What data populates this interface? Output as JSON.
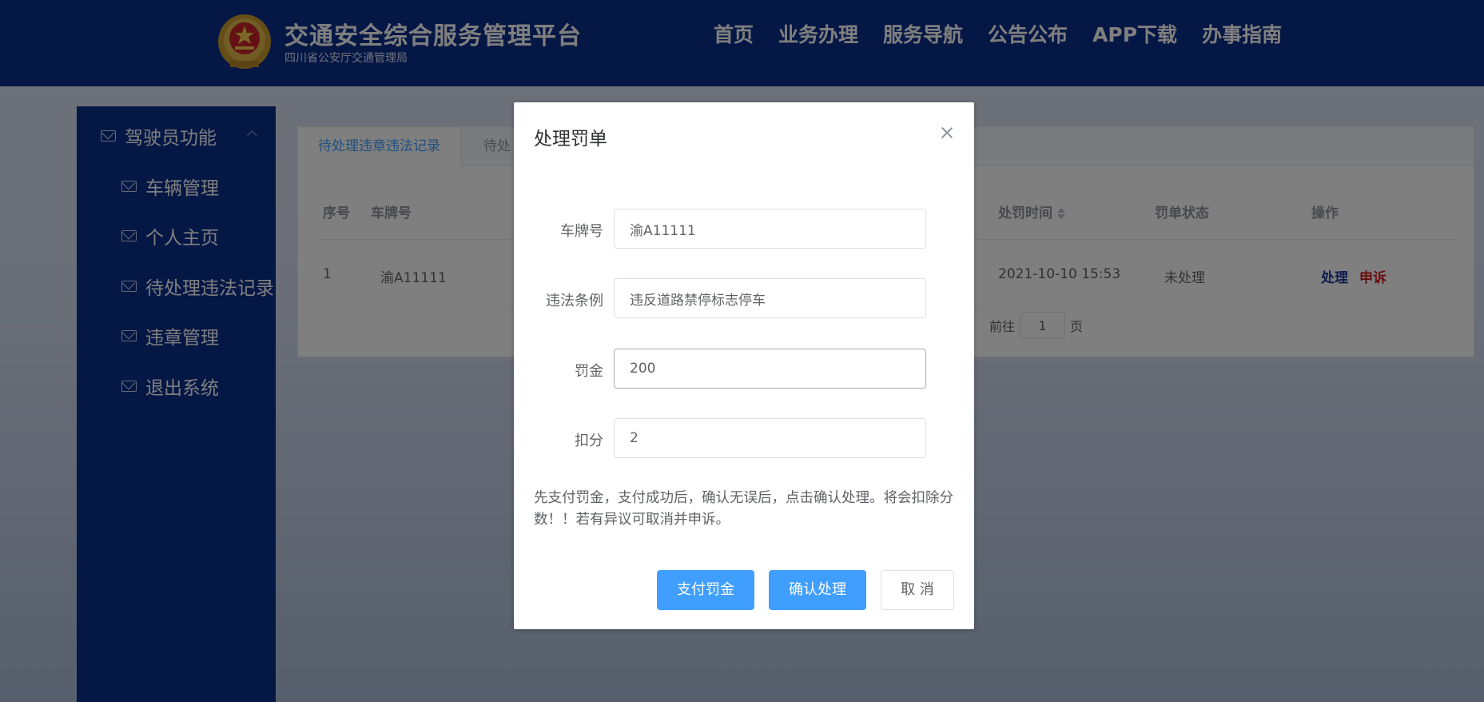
{
  "header": {
    "title": "交通安全综合服务管理平台",
    "subtitle": "四川省公安厅交通管理局",
    "nav": [
      "首页",
      "业务办理",
      "服务导航",
      "公告公布",
      "APP下载",
      "办事指南"
    ]
  },
  "sidebar": {
    "group_label": "驾驶员功能",
    "items": [
      {
        "label": "车辆管理"
      },
      {
        "label": "个人主页"
      },
      {
        "label": "待处理违法记录"
      },
      {
        "label": "违章管理"
      },
      {
        "label": "退出系统"
      }
    ]
  },
  "main": {
    "tabs": [
      {
        "label": "待处理违章违法记录",
        "active": true
      },
      {
        "label": "待处"
      }
    ],
    "table": {
      "headers": {
        "index": "序号",
        "plate": "车牌号",
        "time": "处罚时间",
        "status": "罚单状态",
        "action": "操作"
      },
      "rows": [
        {
          "index": "1",
          "plate": "渝A11111",
          "time": "2021-10-10 15:53",
          "status": "未处理",
          "action_process": "处理",
          "action_appeal": "申诉"
        }
      ]
    },
    "pager": {
      "goto": "前往",
      "page": "1",
      "unit": "页"
    }
  },
  "dialog": {
    "title": "处理罚单",
    "fields": {
      "plate": {
        "label": "车牌号",
        "value": "渝A11111"
      },
      "rule": {
        "label": "违法条例",
        "value": "违反道路禁停标志停车"
      },
      "fine": {
        "label": "罚金",
        "value": "200"
      },
      "points": {
        "label": "扣分",
        "value": "2"
      }
    },
    "note": "先支付罚金，支付成功后，确认无误后，点击确认处理。将会扣除分数！！若有异议可取消并申诉。",
    "buttons": {
      "pay": "支付罚金",
      "confirm": "确认处理",
      "cancel": "取 消"
    }
  },
  "colors": {
    "header_bg": "#0a2f8a",
    "primary": "#409eff",
    "link_process": "#1a3a9c",
    "link_appeal": "#d21a1a"
  },
  "icons": [
    "police-emblem-icon",
    "mail-icon",
    "chevron-up-icon",
    "sort-icon",
    "close-icon"
  ]
}
